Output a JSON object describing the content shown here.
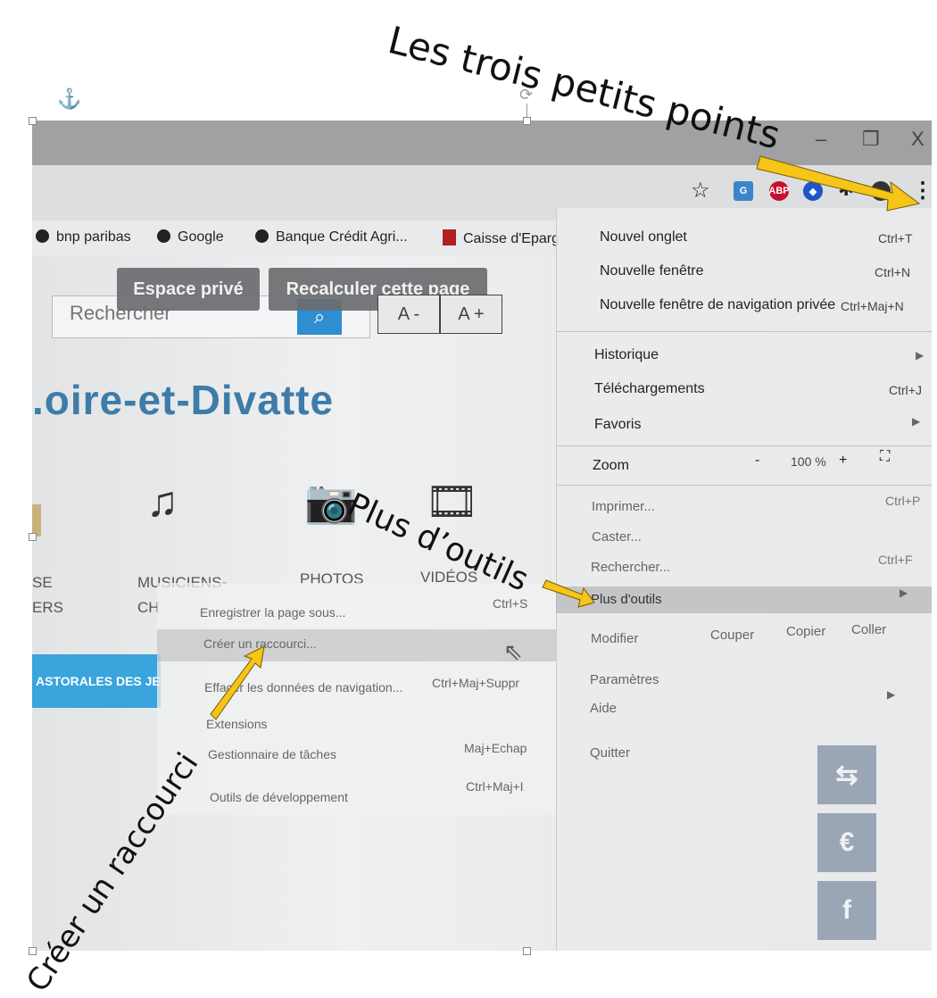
{
  "annotations": {
    "top": "Les trois petits points",
    "middle": "Plus d’outils",
    "bottom": "Créer un raccourci"
  },
  "window": {
    "minimize": "–",
    "restore": "❐",
    "close": "X"
  },
  "bookmarks": [
    {
      "label": "bnp paribas"
    },
    {
      "label": "Google"
    },
    {
      "label": "Banque Crédit Agri..."
    },
    {
      "label": "Caisse d'Eparg"
    }
  ],
  "page": {
    "search_placeholder": "Rechercher",
    "espace_prive": "Espace privé",
    "recalculer": "Recalculer cette page",
    "font_smaller": "A -",
    "font_larger": "A +",
    "site_title": ".oire-et-Divatte",
    "media": [
      {
        "label": "SE",
        "label2": "ERS"
      },
      {
        "label": "MUSICIENS-",
        "label2": "CH"
      },
      {
        "label": "PHOTOS"
      },
      {
        "label": "VIDÉOS"
      }
    ],
    "banner": "ASTORALES DES JE"
  },
  "submenu": {
    "items": [
      {
        "label": "Enregistrer la page sous...",
        "shortcut": "Ctrl+S"
      },
      {
        "label": "Créer un raccourci...",
        "shortcut": ""
      },
      {
        "label": "Effacer les données de navigation...",
        "shortcut": "Ctrl+Maj+Suppr"
      },
      {
        "label": "Extensions",
        "shortcut": ""
      },
      {
        "label": "Gestionnaire de tâches",
        "shortcut": "Maj+Echap"
      },
      {
        "label": "Outils de développement",
        "shortcut": "Ctrl+Maj+I"
      }
    ]
  },
  "menu": {
    "nouvel_onglet": {
      "label": "Nouvel onglet",
      "shortcut": "Ctrl+T"
    },
    "nouvelle_fenetre": {
      "label": "Nouvelle fenêtre",
      "shortcut": "Ctrl+N"
    },
    "navigation_privee": {
      "label": "Nouvelle fenêtre de navigation privée",
      "shortcut": "Ctrl+Maj+N"
    },
    "historique": {
      "label": "Historique"
    },
    "telechargements": {
      "label": "Téléchargements",
      "shortcut": "Ctrl+J"
    },
    "favoris": {
      "label": "Favoris"
    },
    "zoom": {
      "label": "Zoom",
      "minus": "-",
      "value": "100 %",
      "plus": "+"
    },
    "imprimer": {
      "label": "Imprimer...",
      "shortcut": "Ctrl+P"
    },
    "caster": {
      "label": "Caster..."
    },
    "rechercher": {
      "label": "Rechercher...",
      "shortcut": "Ctrl+F"
    },
    "plus_outils": {
      "label": "Plus d'outils"
    },
    "modifier": {
      "label": "Modifier",
      "couper": "Couper",
      "copier": "Copier",
      "coller": "Coller"
    },
    "parametres": {
      "label": "Paramètres"
    },
    "aide": {
      "label": "Aide"
    },
    "quitter": {
      "label": "Quitter"
    }
  },
  "side_buttons": {
    "euro": "€",
    "facebook": "f"
  },
  "colors": {
    "arrow": "#f5c518",
    "accent": "#3d7ca9",
    "menu_bg": "#e9ebec"
  }
}
